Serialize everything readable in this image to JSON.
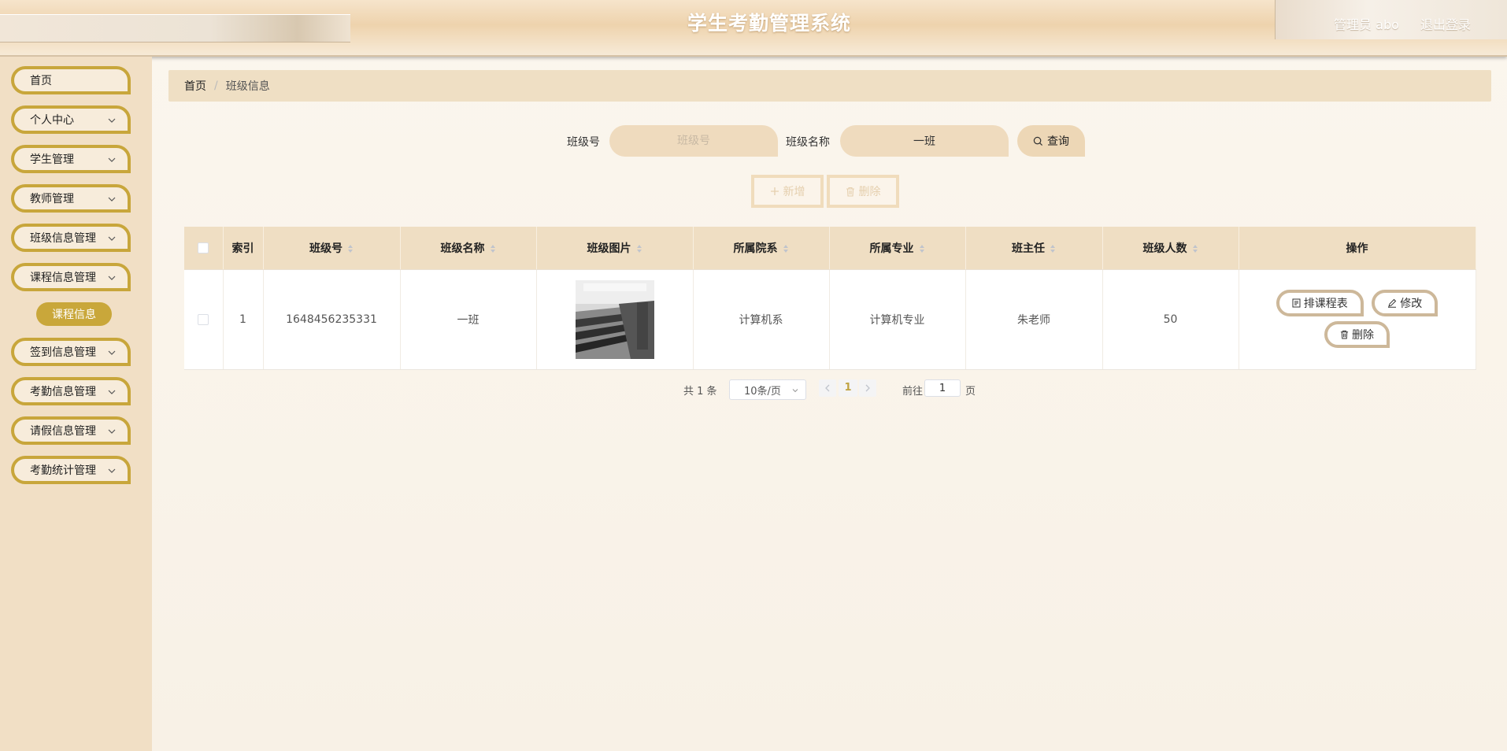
{
  "header": {
    "title": "学生考勤管理系统",
    "user_label": "管理员 abo",
    "logout_label": "退出登录"
  },
  "sidebar": {
    "items": [
      {
        "label": "首页",
        "has_children": false
      },
      {
        "label": "个人中心",
        "has_children": true
      },
      {
        "label": "学生管理",
        "has_children": true
      },
      {
        "label": "教师管理",
        "has_children": true
      },
      {
        "label": "班级信息管理",
        "has_children": true
      },
      {
        "label": "课程信息管理",
        "has_children": true
      },
      {
        "label": "签到信息管理",
        "has_children": true
      },
      {
        "label": "考勤信息管理",
        "has_children": true
      },
      {
        "label": "请假信息管理",
        "has_children": true
      },
      {
        "label": "考勤统计管理",
        "has_children": true
      }
    ],
    "active_subitem": "课程信息"
  },
  "breadcrumb": {
    "home": "首页",
    "separator": "/",
    "current": "班级信息"
  },
  "search": {
    "class_no_label": "班级号",
    "class_no_placeholder": "班级号",
    "class_no_value": "",
    "class_name_label": "班级名称",
    "class_name_placeholder": "班级名称",
    "class_name_value": "一班",
    "query_label": "查询"
  },
  "actions": {
    "add_label": "新增",
    "delete_label": "删除"
  },
  "table": {
    "columns": [
      "索引",
      "班级号",
      "班级名称",
      "班级图片",
      "所属院系",
      "所属专业",
      "班主任",
      "班级人数",
      "操作"
    ],
    "rows": [
      {
        "index": "1",
        "class_no": "1648456235331",
        "class_name": "一班",
        "department": "计算机系",
        "major": "计算机专业",
        "head_teacher": "朱老师",
        "student_count": "50",
        "ops": {
          "schedule": "排课程表",
          "edit": "修改",
          "delete": "删除"
        }
      }
    ]
  },
  "pagination": {
    "total": "共 1 条",
    "page_size": "10条/页",
    "current_page": "1",
    "goto_label": "前往",
    "goto_value": "1",
    "page_suffix": "页"
  },
  "colors": {
    "accent_gold": "#c8a63b",
    "header_bg": "#eed3ad",
    "sidebar_bg": "#f1dfc5",
    "table_header_bg": "#efdec3"
  }
}
